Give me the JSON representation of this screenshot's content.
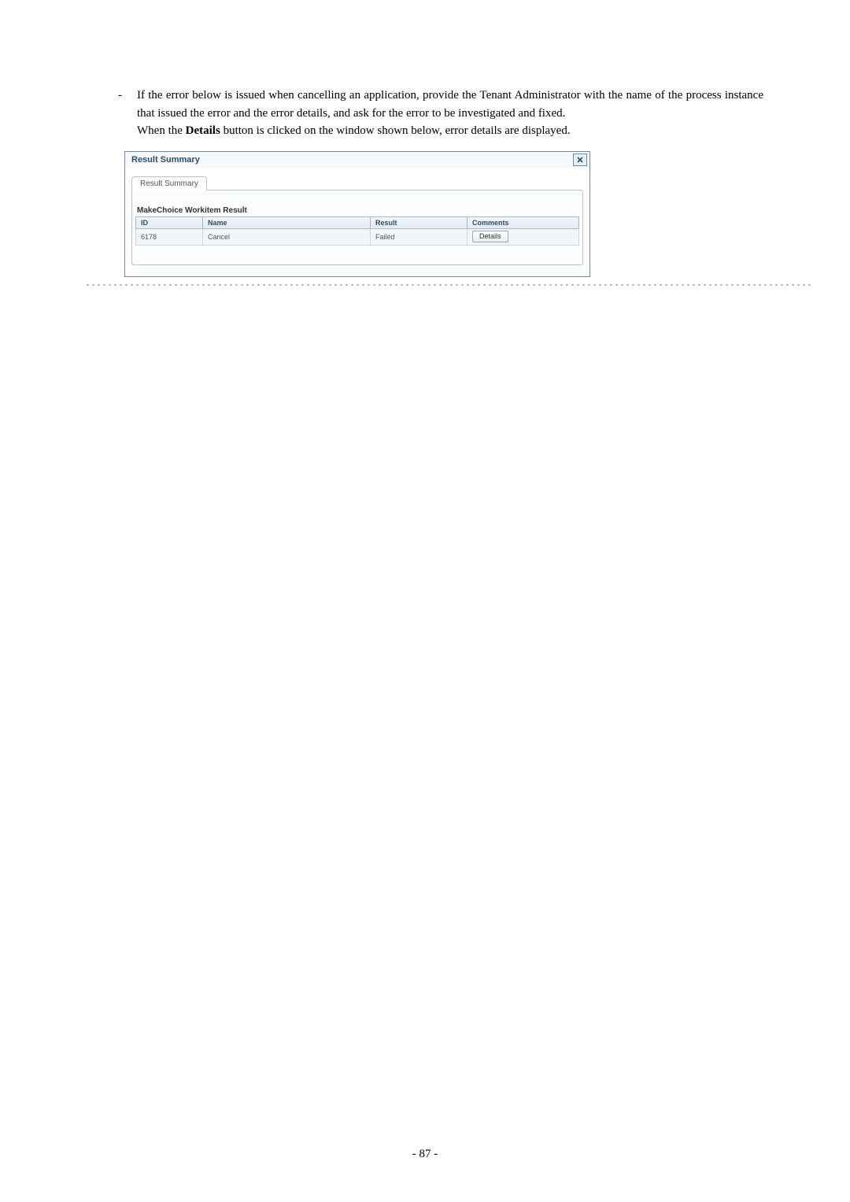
{
  "doc": {
    "bullet_marker": "-",
    "para1": "If the error below is issued when cancelling an application, provide the Tenant Administrator with the name of the process instance that issued the error and the error details, and ask for the error to be investigated and fixed.",
    "para2_pre": "When the ",
    "para2_bold": "Details",
    "para2_post": " button is clicked on the window shown below, error details are displayed.",
    "page_number": "- 87 -"
  },
  "window": {
    "title": "Result Summary",
    "tab_label": "Result Summary",
    "section_title": "MakeChoice Workitem Result",
    "columns": {
      "id": "ID",
      "name": "Name",
      "result": "Result",
      "comments": "Comments"
    },
    "row": {
      "id": "6178",
      "name": "Cancel",
      "result": "Failed",
      "details_button": "Details"
    }
  }
}
